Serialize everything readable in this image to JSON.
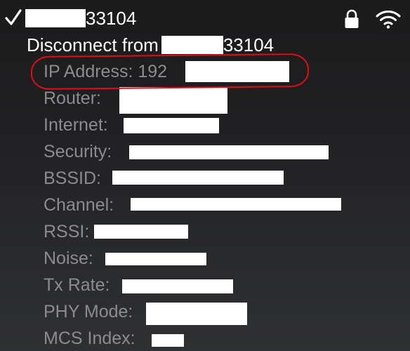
{
  "network": {
    "name_suffix": "33104",
    "selected_mark": "checkmark-icon",
    "icons": [
      "lock-icon",
      "wifi-icon"
    ]
  },
  "disconnect": {
    "prefix": "Disconnect from",
    "suffix": "33104"
  },
  "details": {
    "ip_label": "IP Address: 192",
    "router_label": "Router:",
    "internet_label": "Internet:",
    "security_label": "Security:",
    "bssid_label": "BSSID:",
    "channel_label": "Channel:",
    "rssi_label": "RSSI:",
    "noise_label": "Noise:",
    "txrate_label": "Tx Rate:",
    "phy_label": "PHY Mode:",
    "mcs_label": "MCS Index:"
  },
  "colors": {
    "highlight": "#e30b17",
    "secondary_text": "#8c8c8e"
  }
}
